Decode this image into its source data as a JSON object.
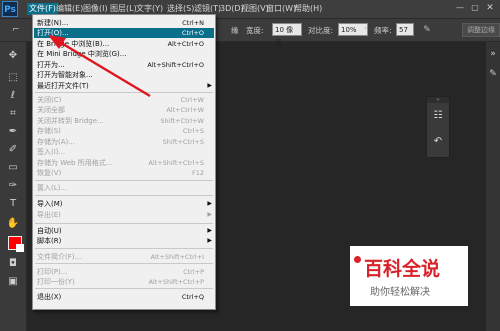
{
  "app": {
    "logo": "Ps"
  },
  "menubar": {
    "items": [
      "文件(F)",
      "编辑(E)",
      "图像(I)",
      "图层(L)",
      "文字(Y)",
      "选择(S)",
      "滤镜(T)",
      "3D(D)",
      "视图(V)",
      "窗口(W)",
      "帮助(H)"
    ],
    "active_index": 0
  },
  "window_controls": {
    "minimize": "—",
    "maximize": "▢",
    "close": "✕"
  },
  "options": {
    "feather_suffix": "缘",
    "width_label": "宽度:",
    "width_value": "10 像素",
    "contrast_label": "对比度:",
    "contrast_value": "10%",
    "frequency_label": "频率:",
    "frequency_value": "57",
    "adjust_edge": "调整边缘",
    "partial_label": "边"
  },
  "file_menu": {
    "items": [
      {
        "label": "新建(N)...",
        "shortcut": "Ctrl+N",
        "disabled": false
      },
      {
        "label": "打开(O)...",
        "shortcut": "Ctrl+O",
        "disabled": false,
        "highlight": true
      },
      {
        "label": "在 Bridge 中浏览(B)...",
        "shortcut": "Alt+Ctrl+O",
        "disabled": false
      },
      {
        "label": "在 Mini Bridge 中浏览(G)...",
        "shortcut": "",
        "disabled": false
      },
      {
        "label": "打开为...",
        "shortcut": "Alt+Shift+Ctrl+O",
        "disabled": false
      },
      {
        "label": "打开为智能对象...",
        "shortcut": "",
        "disabled": false
      },
      {
        "label": "最近打开文件(T)",
        "shortcut": "",
        "disabled": false,
        "submenu": true
      },
      {
        "label": "关闭(C)",
        "shortcut": "Ctrl+W",
        "disabled": true
      },
      {
        "label": "关闭全部",
        "shortcut": "Alt+Ctrl+W",
        "disabled": true
      },
      {
        "label": "关闭并转到 Bridge...",
        "shortcut": "Shift+Ctrl+W",
        "disabled": true
      },
      {
        "label": "存储(S)",
        "shortcut": "Ctrl+S",
        "disabled": true
      },
      {
        "label": "存储为(A)...",
        "shortcut": "Shift+Ctrl+S",
        "disabled": true
      },
      {
        "label": "签入(I)...",
        "shortcut": "",
        "disabled": true
      },
      {
        "label": "存储为 Web 所用格式...",
        "shortcut": "Alt+Shift+Ctrl+S",
        "disabled": true
      },
      {
        "label": "恢复(V)",
        "shortcut": "F12",
        "disabled": true
      },
      {
        "label": "置入(L)...",
        "shortcut": "",
        "disabled": true
      },
      {
        "label": "导入(M)",
        "shortcut": "",
        "disabled": false,
        "submenu": true
      },
      {
        "label": "导出(E)",
        "shortcut": "",
        "disabled": true,
        "submenu": true
      },
      {
        "label": "自动(U)",
        "shortcut": "",
        "disabled": false,
        "submenu": true
      },
      {
        "label": "脚本(R)",
        "shortcut": "",
        "disabled": false,
        "submenu": true
      },
      {
        "label": "文件简介(F)...",
        "shortcut": "Alt+Shift+Ctrl+I",
        "disabled": true
      },
      {
        "label": "打印(P)...",
        "shortcut": "Ctrl+P",
        "disabled": true
      },
      {
        "label": "打印一份(Y)",
        "shortcut": "Alt+Shift+Ctrl+P",
        "disabled": true
      },
      {
        "label": "退出(X)",
        "shortcut": "Ctrl+Q",
        "disabled": false
      }
    ],
    "submenu_arrow": "▶"
  },
  "watermark": {
    "title": "百科全说",
    "subtitle": "助你轻松解决"
  },
  "colors": {
    "accent": "#0a6f8a",
    "foreground_swatch": "#ff0000",
    "background_swatch": "#ffffff",
    "arrow": "#e0151f"
  }
}
